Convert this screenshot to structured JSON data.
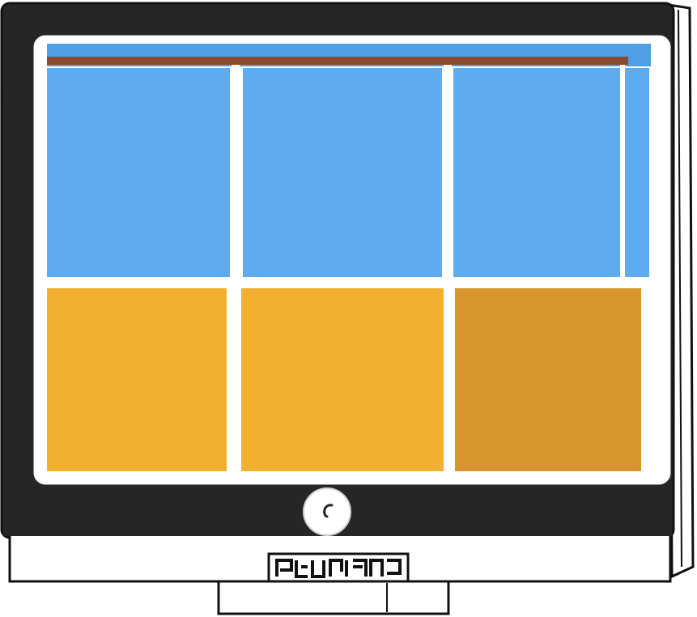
{
  "monitor": {
    "colors": {
      "bezel": "#252525",
      "frame_white": "#ffffff",
      "screen_blue": "#5fabef",
      "screen_blue_dark": "#4f9ee6",
      "tile_yellow": "#f3b030",
      "tile_orange": "#d9952d",
      "top_band": "#8b4a2f",
      "outline": "#111111"
    },
    "screen": {
      "tiles": [
        {
          "name": "tile-top-left",
          "color": "blue"
        },
        {
          "name": "tile-top-middle",
          "color": "blue"
        },
        {
          "name": "tile-top-right",
          "color": "blue"
        },
        {
          "name": "tile-bottom-left",
          "color": "yellow"
        },
        {
          "name": "tile-bottom-middle",
          "color": "yellow"
        },
        {
          "name": "tile-bottom-right",
          "color": "orange"
        }
      ]
    },
    "power_button_icon": "power-button-icon",
    "brand_label": "brand-logo-glyphs"
  }
}
